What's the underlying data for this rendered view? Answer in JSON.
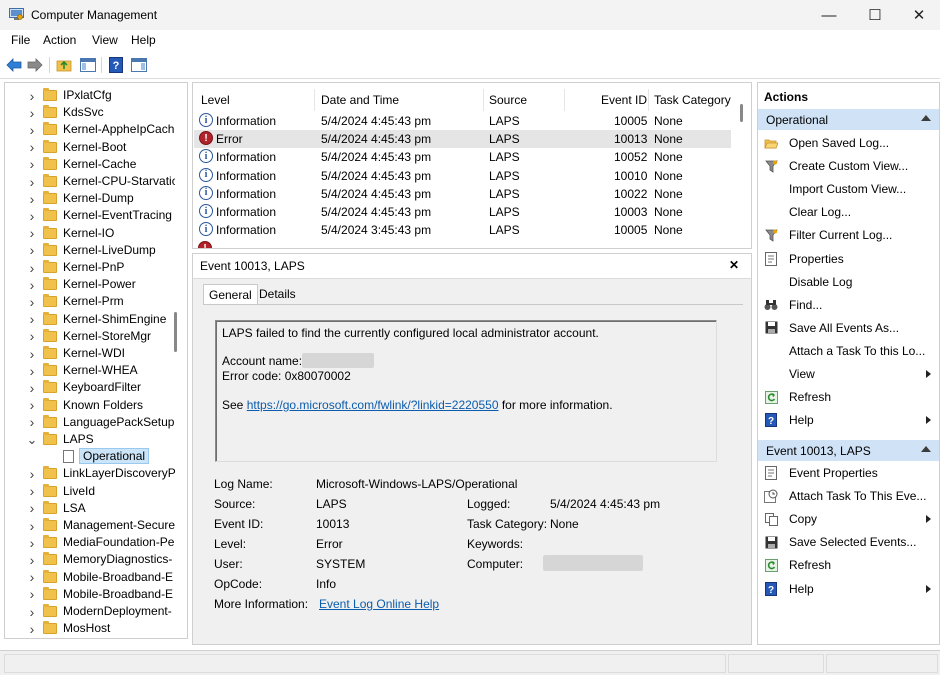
{
  "window": {
    "title": "Computer Management",
    "icon": "computer-management-icon",
    "minimize_glyph": "—",
    "maximize_glyph": "☐",
    "close_glyph": "✕"
  },
  "menu": [
    "File",
    "Action",
    "View",
    "Help"
  ],
  "toolbar": [
    "back-arrow-icon",
    "forward-arrow-icon",
    "up-folder-icon",
    "show-hide-tree-icon",
    "help-icon",
    "action-pane-icon"
  ],
  "tree": {
    "items": [
      {
        "label": "IPxlatCfg",
        "expanded": false
      },
      {
        "label": "KdsSvc",
        "expanded": false
      },
      {
        "label": "Kernel-AppheIpCach",
        "expanded": false
      },
      {
        "label": "Kernel-Boot",
        "expanded": false
      },
      {
        "label": "Kernel-Cache",
        "expanded": false
      },
      {
        "label": "Kernel-CPU-Starvatic",
        "expanded": false
      },
      {
        "label": "Kernel-Dump",
        "expanded": false
      },
      {
        "label": "Kernel-EventTracing",
        "expanded": false
      },
      {
        "label": "Kernel-IO",
        "expanded": false
      },
      {
        "label": "Kernel-LiveDump",
        "expanded": false
      },
      {
        "label": "Kernel-PnP",
        "expanded": false
      },
      {
        "label": "Kernel-Power",
        "expanded": false
      },
      {
        "label": "Kernel-Prm",
        "expanded": false
      },
      {
        "label": "Kernel-ShimEngine",
        "expanded": false
      },
      {
        "label": "Kernel-StoreMgr",
        "expanded": false
      },
      {
        "label": "Kernel-WDI",
        "expanded": false
      },
      {
        "label": "Kernel-WHEA",
        "expanded": false
      },
      {
        "label": "KeyboardFilter",
        "expanded": false
      },
      {
        "label": "Known Folders",
        "expanded": false
      },
      {
        "label": "LanguagePackSetup",
        "expanded": false
      },
      {
        "label": "LAPS",
        "expanded": true
      },
      {
        "label": "Operational",
        "child": true,
        "selected": true
      },
      {
        "label": "LinkLayerDiscoveryPr",
        "expanded": false
      },
      {
        "label": "LiveId",
        "expanded": false
      },
      {
        "label": "LSA",
        "expanded": false
      },
      {
        "label": "Management-Secure",
        "expanded": false
      },
      {
        "label": "MediaFoundation-Pe",
        "expanded": false
      },
      {
        "label": "MemoryDiagnostics-",
        "expanded": false
      },
      {
        "label": "Mobile-Broadband-E",
        "expanded": false
      },
      {
        "label": "Mobile-Broadband-E",
        "expanded": false
      },
      {
        "label": "ModernDeployment-",
        "expanded": false
      },
      {
        "label": "MosHost",
        "expanded": false
      }
    ]
  },
  "events": {
    "columns": [
      "Level",
      "Date and Time",
      "Source",
      "Event ID",
      "Task Category"
    ],
    "rows": [
      {
        "level": "Information",
        "date": "5/4/2024 4:45:43 pm",
        "source": "LAPS",
        "id": "10005",
        "category": "None"
      },
      {
        "level": "Error",
        "date": "5/4/2024 4:45:43 pm",
        "source": "LAPS",
        "id": "10013",
        "category": "None",
        "selected": true
      },
      {
        "level": "Information",
        "date": "5/4/2024 4:45:43 pm",
        "source": "LAPS",
        "id": "10052",
        "category": "None"
      },
      {
        "level": "Information",
        "date": "5/4/2024 4:45:43 pm",
        "source": "LAPS",
        "id": "10010",
        "category": "None"
      },
      {
        "level": "Information",
        "date": "5/4/2024 4:45:43 pm",
        "source": "LAPS",
        "id": "10022",
        "category": "None"
      },
      {
        "level": "Information",
        "date": "5/4/2024 4:45:43 pm",
        "source": "LAPS",
        "id": "10003",
        "category": "None"
      },
      {
        "level": "Information",
        "date": "5/4/2024 3:45:43 pm",
        "source": "LAPS",
        "id": "10005",
        "category": "None"
      }
    ]
  },
  "detail": {
    "header": "Event 10013, LAPS",
    "close_glyph": "✕",
    "tabs": [
      "General",
      "Details"
    ],
    "message_line1": "LAPS failed to find the currently configured local administrator account.",
    "account_label": "Account name:",
    "error_code": "Error code: 0x80070002",
    "see_prefix": "See",
    "see_link": "https://go.microsoft.com/fwlink/?linkid=2220550",
    "see_suffix": "for more information.",
    "props": {
      "log_name_label": "Log Name:",
      "log_name": "Microsoft-Windows-LAPS/Operational",
      "source_label": "Source:",
      "source": "LAPS",
      "logged_label": "Logged:",
      "logged": "5/4/2024 4:45:43 pm",
      "event_id_label": "Event ID:",
      "event_id": "10013",
      "task_category_label": "Task Category:",
      "task_category": "None",
      "level_label": "Level:",
      "level": "Error",
      "keywords_label": "Keywords:",
      "user_label": "User:",
      "user": "SYSTEM",
      "computer_label": "Computer:",
      "opcode_label": "OpCode:",
      "opcode": "Info",
      "more_info_label": "More Information:",
      "more_info_link": "Event Log Online Help"
    }
  },
  "actions": {
    "title": "Actions",
    "section1": "Operational",
    "section1_items": [
      {
        "label": "Open Saved Log...",
        "icon": "open-folder-icon"
      },
      {
        "label": "Create Custom View...",
        "icon": "filter-icon"
      },
      {
        "label": "Import Custom View...",
        "icon": ""
      },
      {
        "label": "Clear Log...",
        "icon": ""
      },
      {
        "label": "Filter Current Log...",
        "icon": "filter-icon"
      },
      {
        "label": "Properties",
        "icon": "properties-icon"
      },
      {
        "label": "Disable Log",
        "icon": ""
      },
      {
        "label": "Find...",
        "icon": "binoculars-icon"
      },
      {
        "label": "Save All Events As...",
        "icon": "save-icon"
      },
      {
        "label": "Attach a Task To this Lo...",
        "icon": ""
      },
      {
        "label": "View",
        "icon": "",
        "submenu": true
      },
      {
        "label": "Refresh",
        "icon": "refresh-icon"
      },
      {
        "label": "Help",
        "icon": "help-icon",
        "submenu": true
      }
    ],
    "section2": "Event 10013, LAPS",
    "section2_items": [
      {
        "label": "Event Properties",
        "icon": "properties-icon"
      },
      {
        "label": "Attach Task To This Eve...",
        "icon": "task-icon"
      },
      {
        "label": "Copy",
        "icon": "copy-icon",
        "submenu": true
      },
      {
        "label": "Save Selected Events...",
        "icon": "save-icon"
      },
      {
        "label": "Refresh",
        "icon": "refresh-icon"
      },
      {
        "label": "Help",
        "icon": "help-icon",
        "submenu": true
      }
    ]
  },
  "colors": {
    "selection": "#cce4f7",
    "section_header": "#cfe2f6",
    "link": "#0b5cad",
    "error": "#b0232a",
    "info": "#2b579a"
  }
}
